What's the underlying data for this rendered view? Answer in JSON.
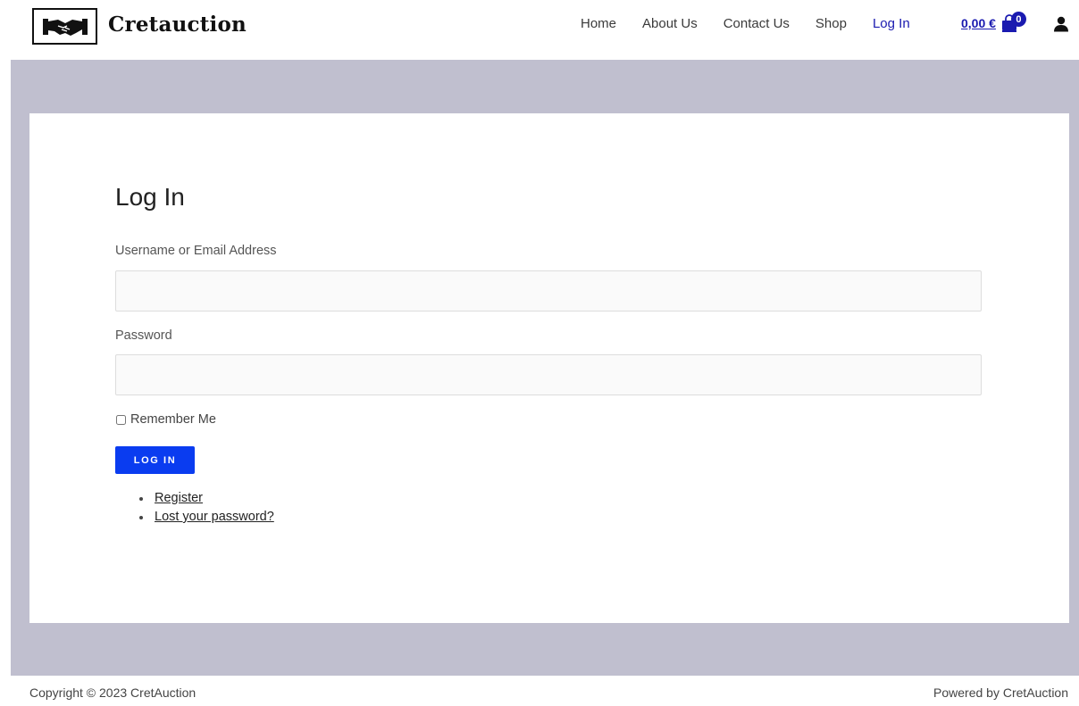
{
  "header": {
    "brand": "Cretauction",
    "logo_icon": "handshake-icon",
    "nav": [
      {
        "label": "Home"
      },
      {
        "label": "About Us"
      },
      {
        "label": "Contact Us"
      },
      {
        "label": "Shop"
      },
      {
        "label": "Log In",
        "active": true
      }
    ],
    "cart_total": "0,00 €",
    "cart_count": "0",
    "cart_icon": "shopping-bag-icon",
    "account_icon": "user-icon",
    "accent_color": "#1a1ab0"
  },
  "login": {
    "title": "Log In",
    "username_label": "Username or Email Address",
    "username_value": "",
    "password_label": "Password",
    "password_value": "",
    "remember_label": "Remember Me",
    "remember_checked": false,
    "submit_label": "LOG IN",
    "links": [
      {
        "label": "Register"
      },
      {
        "label": "Lost your password?"
      }
    ],
    "button_color": "#0a3cf0"
  },
  "colors": {
    "page_background": "#c0bfcf"
  },
  "footer": {
    "copyright": "Copyright © 2023 CretAuction",
    "powered": "Powered by CretAuction"
  }
}
